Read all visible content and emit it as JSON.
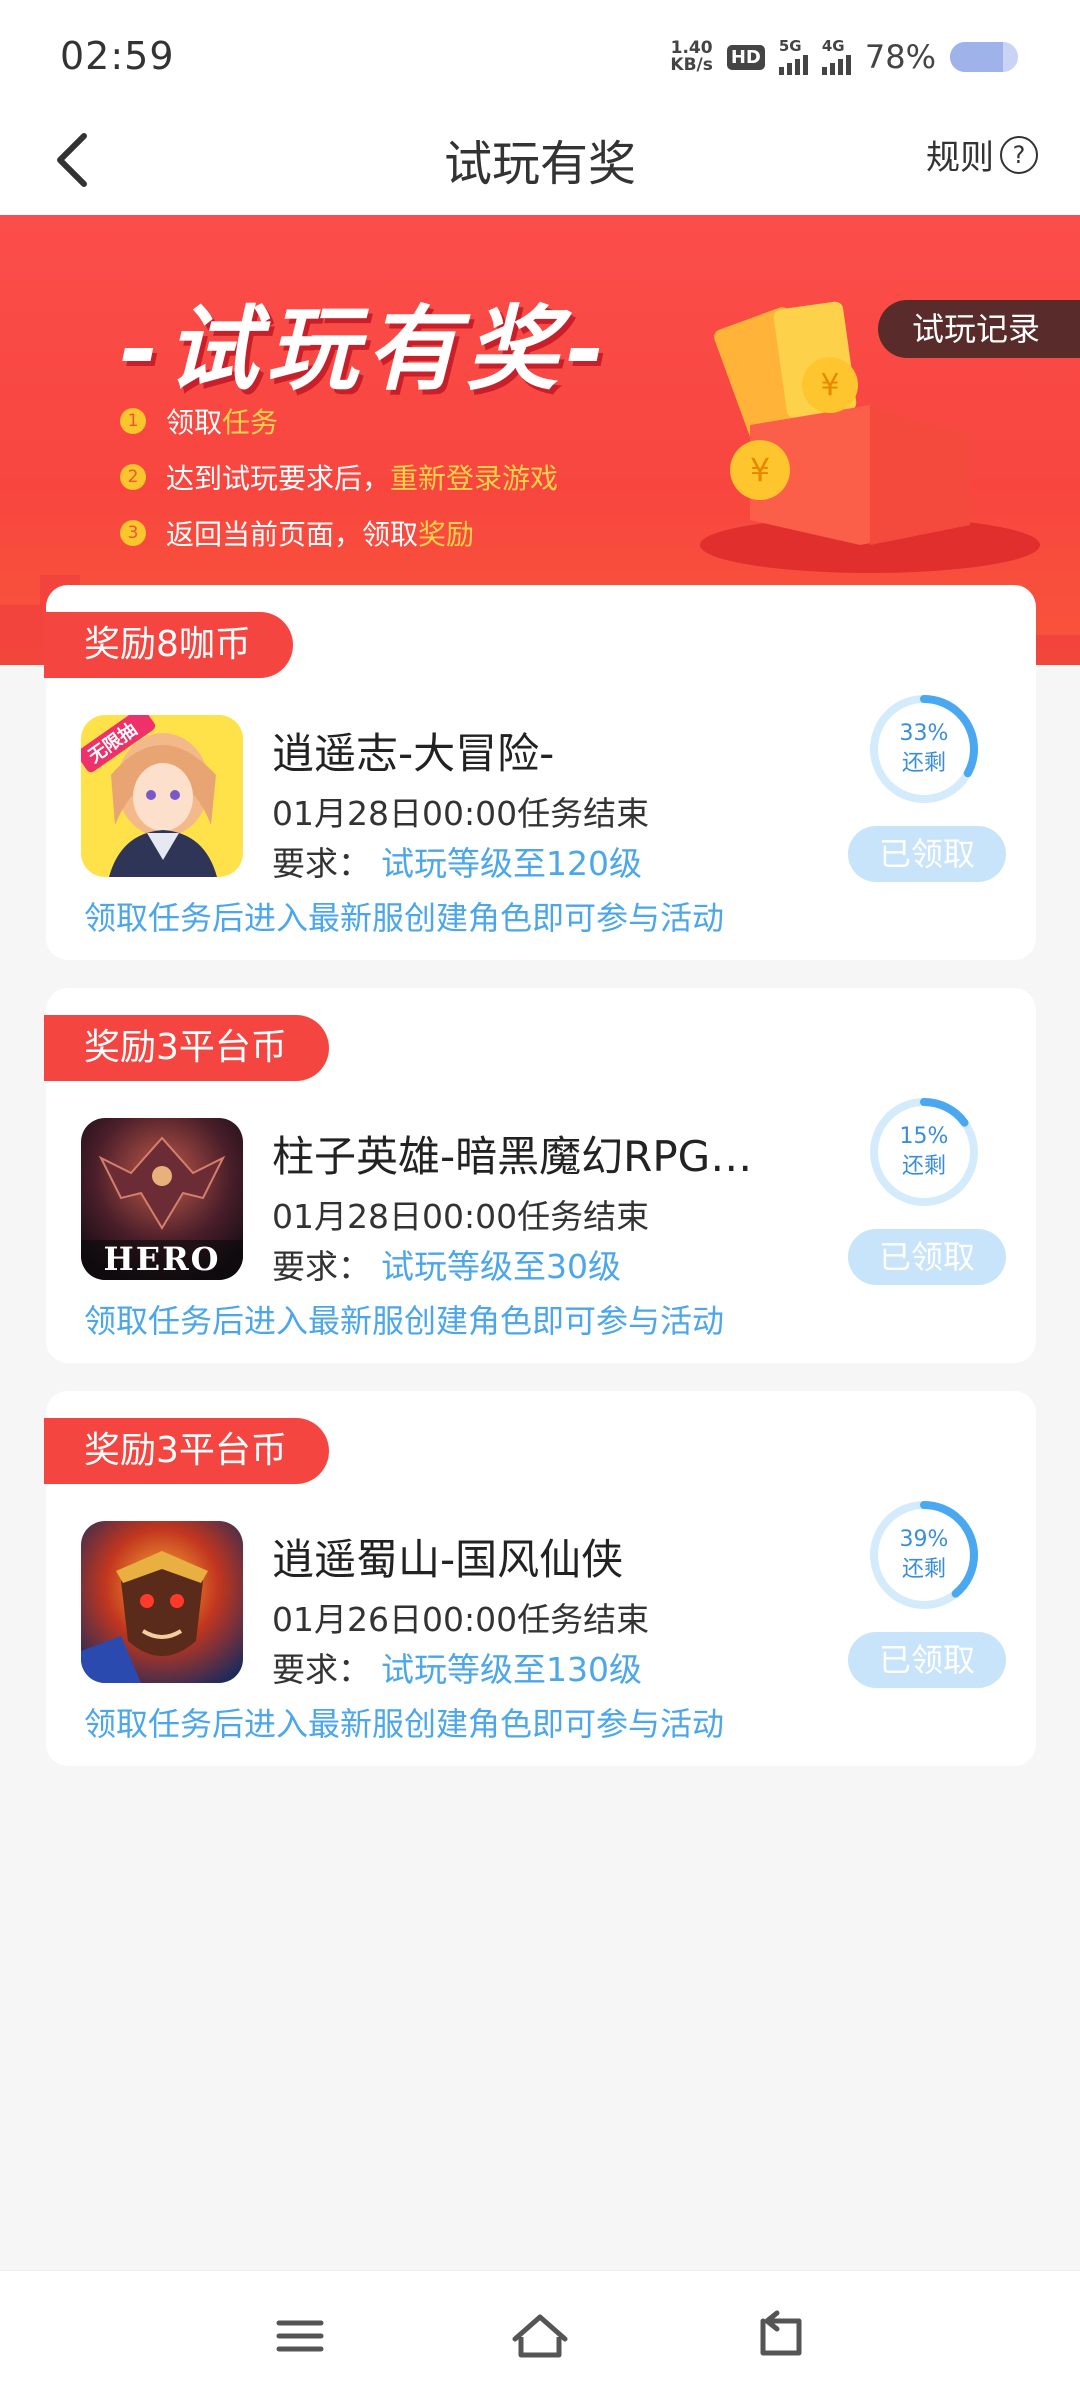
{
  "status_bar": {
    "time": "02:59",
    "net_speed_value": "1.40",
    "net_speed_unit": "KB/s",
    "hd_label": "HD",
    "signal_1_label": "5G",
    "signal_2_label": "4G",
    "battery_percent_text": "78%",
    "battery_level": 0.78
  },
  "nav": {
    "title": "试玩有奖",
    "rules_label": "规则",
    "help_glyph": "?"
  },
  "banner": {
    "title": "-试玩有奖-",
    "record_button": "试玩记录",
    "steps": [
      {
        "num": "1",
        "text": "领取",
        "highlight": "任务",
        "suffix": ""
      },
      {
        "num": "2",
        "text": "达到试玩要求后，",
        "highlight": "重新登录游戏",
        "suffix": ""
      },
      {
        "num": "3",
        "text": "返回当前页面，领取",
        "highlight": "奖励",
        "suffix": ""
      }
    ]
  },
  "tasks": [
    {
      "reward": "奖励8咖币",
      "name": "逍遥志-大冒险-",
      "deadline": "01月28日00:00任务结束",
      "req_label": "要求：",
      "req_value": "试玩等级至120级",
      "note": "领取任务后进入最新服创建角色即可参与活动",
      "progress_percent": 33,
      "progress_text": "33%",
      "remaining_label": "还剩",
      "claim_label": "已领取",
      "icon_badge": "无限抽",
      "icon": "anime-girl-game-icon"
    },
    {
      "reward": "奖励3平台币",
      "name": "柱子英雄-暗黑魔幻RPG…",
      "deadline": "01月28日00:00任务结束",
      "req_label": "要求：",
      "req_value": "试玩等级至30级",
      "note": "领取任务后进入最新服创建角色即可参与活动",
      "progress_percent": 15,
      "progress_text": "15%",
      "remaining_label": "还剩",
      "claim_label": "已领取",
      "icon_text": "HERO",
      "icon": "dragon-hero-game-icon"
    },
    {
      "reward": "奖励3平台币",
      "name": "逍遥蜀山-国风仙侠",
      "deadline": "01月26日00:00任务结束",
      "req_label": "要求：",
      "req_value": "试玩等级至130级",
      "note": "领取任务后进入最新服创建角色即可参与活动",
      "progress_percent": 39,
      "progress_text": "39%",
      "remaining_label": "还剩",
      "claim_label": "已领取",
      "icon": "monkey-king-game-icon"
    }
  ],
  "system_nav": {
    "menu": "menu-icon",
    "home": "home-icon",
    "back": "back-icon"
  },
  "colors": {
    "accent_red": "#f44540",
    "link_blue": "#4ba6ea",
    "claimed_button": "#c8e4fb",
    "progress_ring": "#4aa8f0"
  }
}
